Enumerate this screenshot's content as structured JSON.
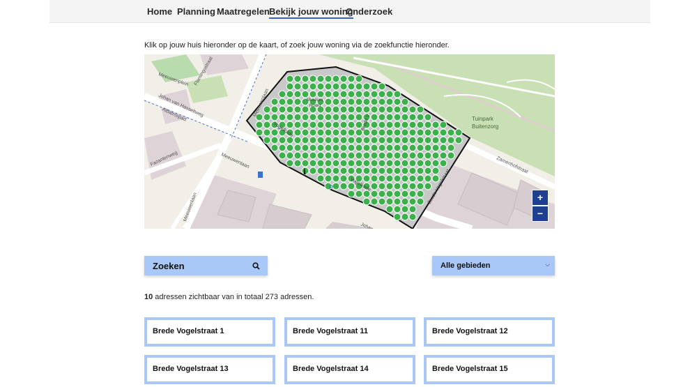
{
  "nav": {
    "items": [
      "Home",
      "Planning",
      "Maatregelen",
      "Bekijk jouw woning",
      "Onderzoek"
    ],
    "active": "Bekijk jouw woning"
  },
  "intro_text": "Klik op jouw huis hieronder op de kaart, of zoek jouw woning via de zoekfunctie hieronder.",
  "map": {
    "labels": {
      "meeuwenplein": "Meeuwenplein",
      "flamingostraat": "Flamingostraat",
      "johan_van_hasseltweg": "Johan van Hasseltweg",
      "albatrospad": "Albatrospad",
      "meeuwenlaan_top": "Meeuwenlaan",
      "meeuwenlaan_bottom": "Meeuwenlaan",
      "meeuwenlaan_left": "Meeuwenlaan",
      "fazantenweg": "Fazantenweg",
      "vogelkade": "Vogelkade",
      "vogelkade_lower": "Vogelkade",
      "johan_bottom": "Johan",
      "zamenhofstraat": "Zamenhofstraat",
      "tuinpark": "Tuinpark",
      "buitenzorg": "Buitenzorg",
      "museum": "Museum",
      "noord": "Noord",
      "zesde_vogelstraat": "Zesde Vogelstraat",
      "brede_vogelstraat": "Brede V."
    },
    "zoom_in": "+",
    "zoom_out": "−",
    "colors": {
      "district_fill": "#c8c8c8",
      "house_marker": "#3cb04a",
      "park": "#c8e0b4"
    }
  },
  "search": {
    "placeholder": "Zoeken",
    "icon": "search-icon"
  },
  "area_filter": {
    "selected": "Alle gebieden",
    "icon": "chevron-down-icon"
  },
  "results": {
    "visible_count": "10",
    "summary_text": " adressen zichtbaar van in totaal 273 adressen."
  },
  "addresses": [
    "Brede Vogelstraat 1",
    "Brede Vogelstraat 11",
    "Brede Vogelstraat 12",
    "Brede Vogelstraat 13",
    "Brede Vogelstraat 14",
    "Brede Vogelstraat 15"
  ],
  "accent_colors": {
    "nav_active_underline": "#3b5fc0",
    "control_bg": "#a9c8f7",
    "zoom_bg": "#1f3f8f"
  }
}
